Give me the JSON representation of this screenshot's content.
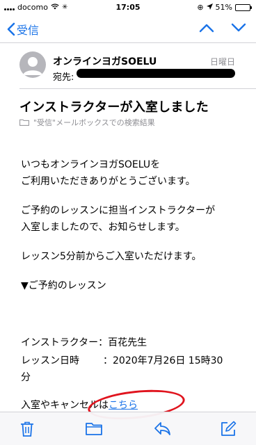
{
  "status_bar": {
    "carrier": "docomo",
    "time": "17:05",
    "battery": "51%",
    "battery_level": 0.51
  },
  "nav": {
    "back_label": "受信"
  },
  "message": {
    "sender": "オンラインヨガSOELU",
    "date": "日曜日",
    "to_label": "宛先:",
    "subject": "インストラクターが入室しました",
    "folder_note": "\"受信\"メールボックスでの検索結果",
    "body": {
      "p1_line1": "いつもオンラインヨガSOELUを",
      "p1_line2": "ご利用いただきありがとうございます。",
      "p2_line1": "ご予約のレッスンに担当インストラクターが",
      "p2_line2": "入室しましたので、お知らせします。",
      "p3": "レッスン5分前からご入室いただけます。",
      "p4": "▼ご予約のレッスン",
      "instructor_label": "インストラクター：",
      "instructor_value": "百花先生",
      "datetime_label": "レッスン日時",
      "datetime_sep": "：",
      "datetime_value": "2020年7月26日 15時30",
      "datetime_value_cont": "分",
      "link_prefix": "入室やキャンセルは",
      "link_text": "こちら"
    }
  },
  "colors": {
    "accent": "#1a73e8",
    "annotation": "#e0141e"
  }
}
